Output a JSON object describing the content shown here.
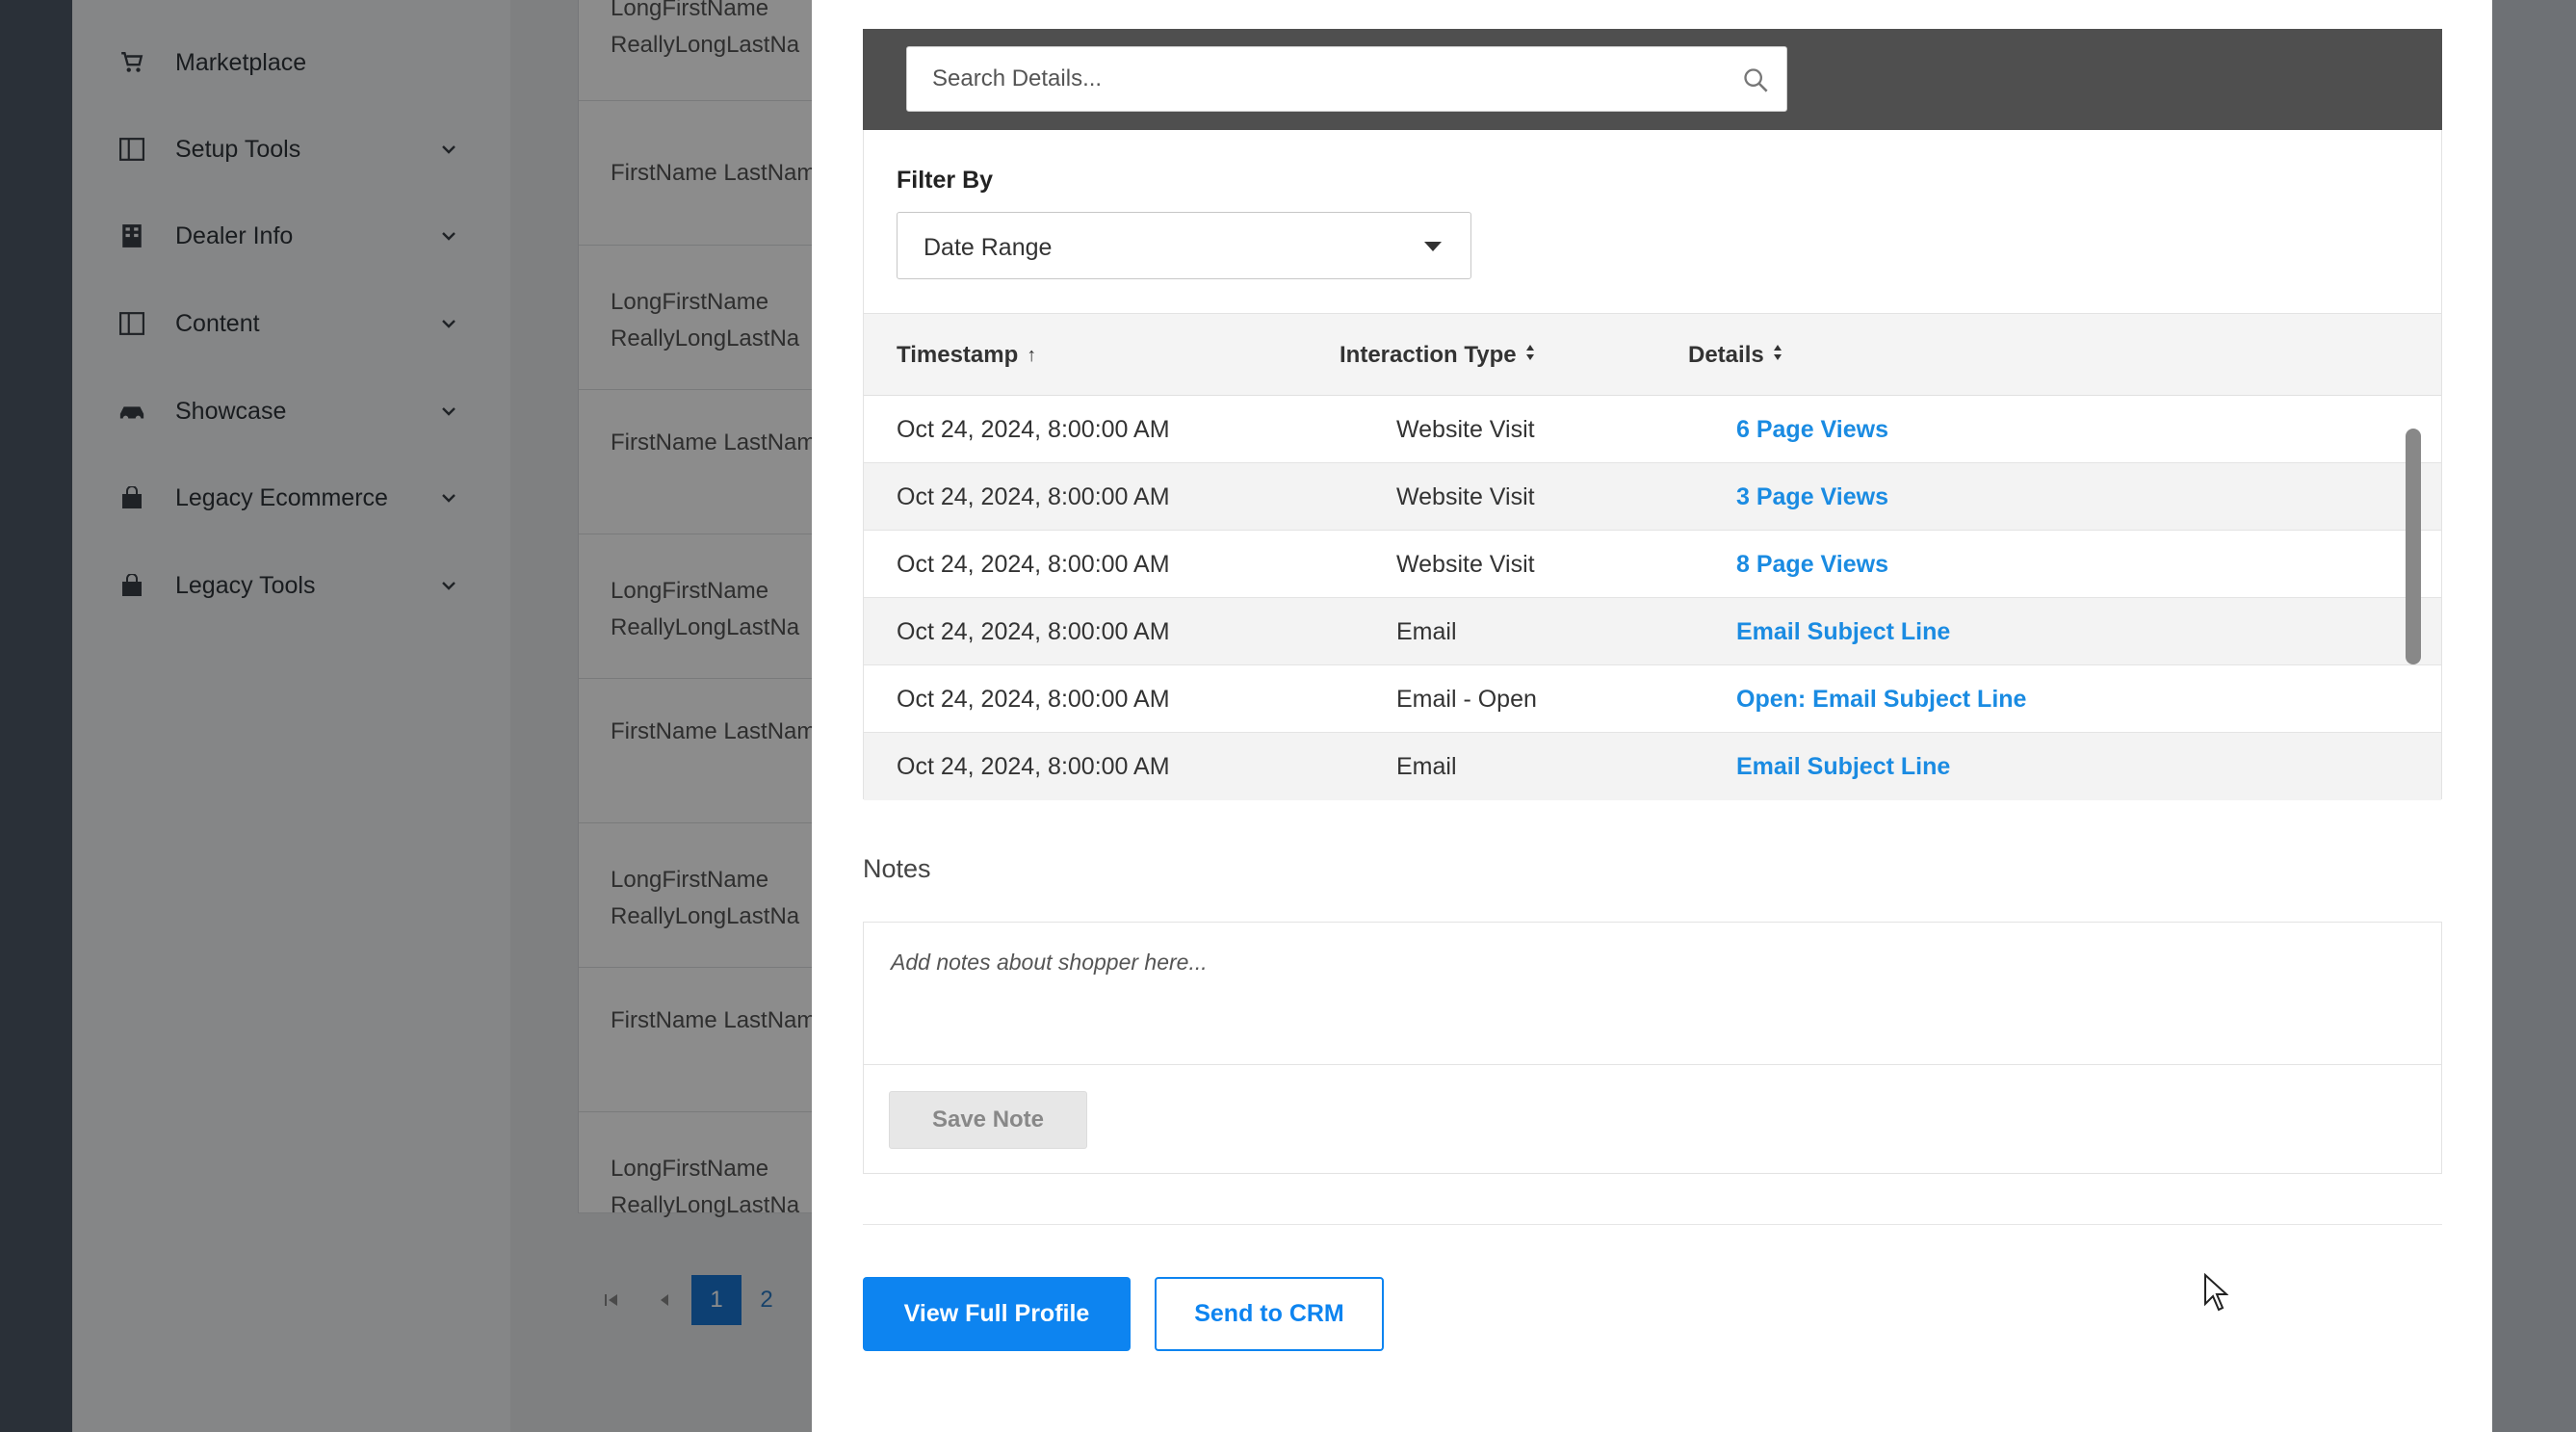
{
  "sidebar": {
    "items": [
      {
        "label": "Marketplace",
        "icon": "cart-icon",
        "has_chevron": false
      },
      {
        "label": "Setup Tools",
        "icon": "panel-icon",
        "has_chevron": true
      },
      {
        "label": "Dealer Info",
        "icon": "building-icon",
        "has_chevron": true
      },
      {
        "label": "Content",
        "icon": "panel-icon",
        "has_chevron": true
      },
      {
        "label": "Showcase",
        "icon": "car-icon",
        "has_chevron": true
      },
      {
        "label": "Legacy Ecommerce",
        "icon": "bag-icon",
        "has_chevron": true
      },
      {
        "label": "Legacy Tools",
        "icon": "bag-icon",
        "has_chevron": true
      }
    ]
  },
  "background_list": {
    "rows": [
      {
        "line1": "LongFirstName",
        "line2": "ReallyLongLastNa"
      },
      {
        "line1": "FirstName LastNam",
        "line2": ""
      },
      {
        "line1": "LongFirstName",
        "line2": "ReallyLongLastNa"
      },
      {
        "line1": "FirstName LastNam",
        "line2": ""
      },
      {
        "line1": "LongFirstName",
        "line2": "ReallyLongLastNa"
      },
      {
        "line1": "FirstName LastNam",
        "line2": ""
      },
      {
        "line1": "LongFirstName",
        "line2": "ReallyLongLastNa"
      },
      {
        "line1": "FirstName LastNam",
        "line2": ""
      },
      {
        "line1": "LongFirstName",
        "line2": "ReallyLongLastNa"
      }
    ],
    "pager": {
      "pages": [
        "1",
        "2"
      ],
      "active": "1"
    }
  },
  "modal": {
    "search": {
      "placeholder": "Search Details..."
    },
    "filter": {
      "label": "Filter By",
      "selected": "Date Range"
    },
    "table": {
      "headers": {
        "timestamp": "Timestamp",
        "timestamp_sort": "↑",
        "interaction_type": "Interaction Type",
        "details": "Details"
      },
      "rows": [
        {
          "timestamp": "Oct 24, 2024, 8:00:00 AM",
          "type": "Website Visit",
          "details": "6 Page Views"
        },
        {
          "timestamp": "Oct 24, 2024, 8:00:00 AM",
          "type": "Website Visit",
          "details": "3 Page Views"
        },
        {
          "timestamp": "Oct 24, 2024, 8:00:00 AM",
          "type": "Website Visit",
          "details": "8 Page Views"
        },
        {
          "timestamp": "Oct 24, 2024, 8:00:00 AM",
          "type": "Email",
          "details": "Email Subject Line"
        },
        {
          "timestamp": "Oct 24, 2024, 8:00:00 AM",
          "type": "Email - Open",
          "details": "Open: Email Subject Line"
        },
        {
          "timestamp": "Oct 24, 2024, 8:00:00 AM",
          "type": "Email",
          "details": "Email Subject Line"
        }
      ]
    },
    "notes": {
      "label": "Notes",
      "placeholder": "Add notes about shopper here...",
      "save_label": "Save Note"
    },
    "actions": {
      "view_profile": "View Full Profile",
      "send_crm": "Send to CRM"
    }
  },
  "colors": {
    "primary": "#0d84f0",
    "link": "#1a8be2",
    "search_bar_bg": "#4f4f4f"
  }
}
